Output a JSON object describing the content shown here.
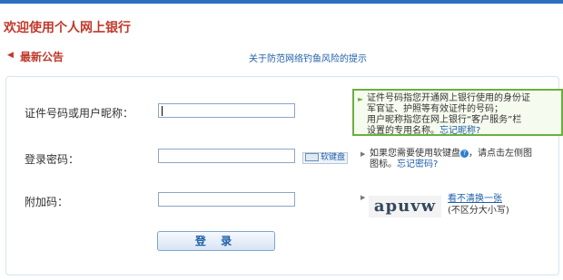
{
  "header": {
    "welcome": "欢迎使用个人网上银行"
  },
  "notice": {
    "label": "最新公告",
    "link": "关于防范网络钓鱼风险的提示"
  },
  "form": {
    "id_label": "证件号码或用户昵称：",
    "password_label": "登录密码：",
    "captcha_label": "附加码：",
    "soft_keyboard": "软键盘",
    "login_button": "登 录"
  },
  "tips": {
    "id_tip_line1": "证件号码指您开通网上银行使用的身份证",
    "id_tip_line2": "军官证、护照等有效证件的号码；",
    "id_tip_line3": "用户昵称指您在网上银行“客户服务”栏",
    "id_tip_line4_text": "设置的专用名称。",
    "id_tip_line4_link": "忘记昵称?",
    "pwd_tip_line1": "如果您需要使用软键盘",
    "pwd_tip_line1b": "，请点击左侧图",
    "pwd_tip_line2_text": "图标。",
    "pwd_tip_line2_link": "忘记密码?"
  },
  "captcha": {
    "image_text": "apuvw",
    "refresh_link": "看不清换一张",
    "case_note": "(不区分大小写)"
  },
  "colors": {
    "brand": "#c0392b",
    "link": "#1f5fa8",
    "tip_border": "#67b13e"
  }
}
